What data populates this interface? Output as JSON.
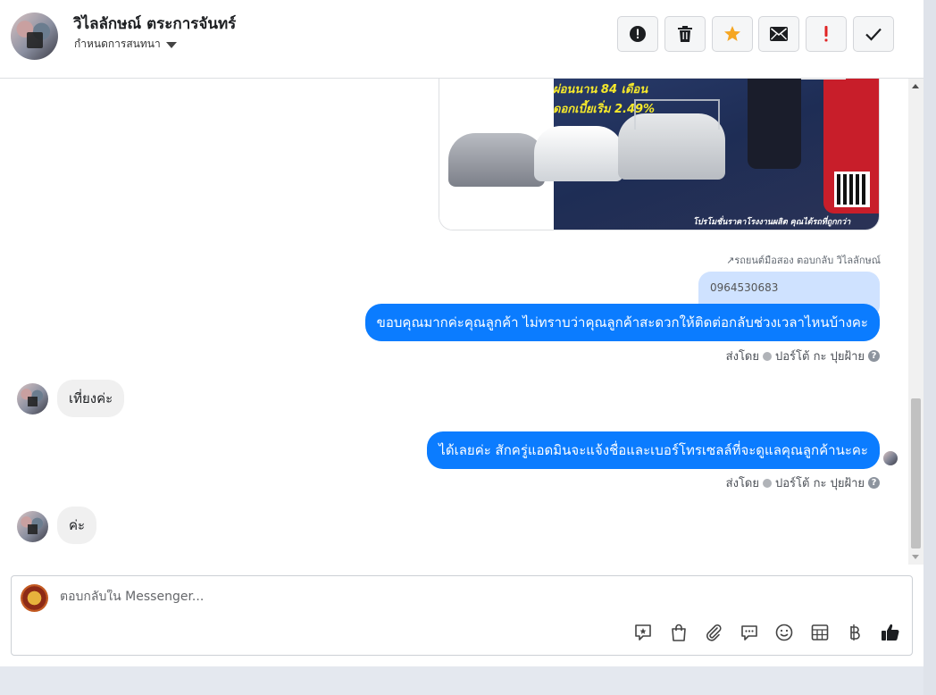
{
  "header": {
    "contact_name": "วิไลลักษณ์ ตระการจันทร์",
    "assign_label": "กำหนดการสนทนา",
    "toolbar": [
      {
        "name": "mark-spam-button",
        "icon": "alert-circle-icon"
      },
      {
        "name": "delete-button",
        "icon": "trash-icon"
      },
      {
        "name": "star-button",
        "icon": "star-icon"
      },
      {
        "name": "mark-unread-button",
        "icon": "envelope-icon"
      },
      {
        "name": "follow-up-button",
        "icon": "exclamation-icon"
      },
      {
        "name": "mark-done-button",
        "icon": "checkmark-icon"
      }
    ]
  },
  "ad_image": {
    "line1": "ผ่อนนาน 84 เดือน",
    "line2": "ดอกเบี้ยเริ่ม 2.49%",
    "footer": "โปรโมชั่นราคาโรงงานผลิต คุณได้รถที่ถูกกว่า"
  },
  "messages": {
    "reply_note": "รถยนต์มือสอง ตอบกลับ วิไลลักษณ์",
    "phone": "0964530683",
    "msg1": "ขอบคุณมากค่ะคุณลูกค้า ไม่ทราบว่าคุณลูกค้าสะดวกให้ติดต่อกลับช่วงเวลาไหนบ้างคะ",
    "sent_by_1": "ส่งโดย",
    "sender_1": "ปอร์โต้ กะ ปุยฝ้าย",
    "msg2": "เที่ยงค่ะ",
    "msg3": "ได้เลยค่ะ สักครู่แอดมินจะแจ้งชื่อและเบอร์โทรเซลล์ที่จะดูแลคุณลูกค้านะคะ",
    "sent_by_2": "ส่งโดย",
    "sender_2": "ปอร์โต้ กะ ปุยฝ้าย",
    "msg4": "ค่ะ"
  },
  "composer": {
    "placeholder": "ตอบกลับใน Messenger...",
    "tools": [
      "saved-reply-icon",
      "shopping-bag-icon",
      "paperclip-icon",
      "chat-bubble-icon",
      "smiley-icon",
      "table-icon",
      "baht-icon",
      "thumbs-up-icon"
    ]
  },
  "colors": {
    "bubble_out": "#0b7cff",
    "bubble_in": "#f0f0f0",
    "phone_bubble": "#cfe2ff",
    "star": "#f5a623",
    "follow_up": "#e02424"
  }
}
